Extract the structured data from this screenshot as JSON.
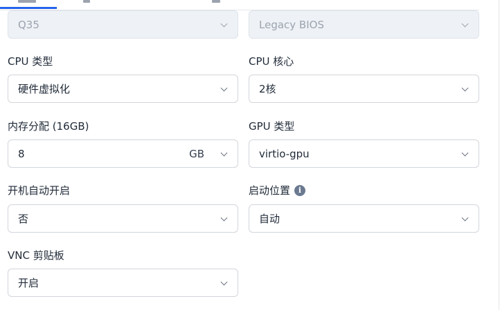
{
  "form": {
    "machine_type": {
      "value": "Q35"
    },
    "firmware": {
      "value": "Legacy BIOS"
    },
    "cpu_type": {
      "label": "CPU 类型",
      "value": "硬件虚拟化"
    },
    "cpu_cores": {
      "label": "CPU 核心",
      "value": "2核"
    },
    "memory": {
      "label": "内存分配 (16GB)",
      "value": "8",
      "unit": "GB"
    },
    "gpu_type": {
      "label": "GPU 类型",
      "value": "virtio-gpu"
    },
    "autostart": {
      "label": "开机自动开启",
      "value": "否"
    },
    "boot_location": {
      "label": "启动位置",
      "value": "自动",
      "info_icon": "info-icon"
    },
    "vnc_clipboard": {
      "label": "VNC 剪贴板",
      "value": "开启"
    }
  },
  "colors": {
    "accent": "#2563eb",
    "border": "#d1d5db",
    "disabled_bg": "#eef2f6",
    "info_icon": "#6b7a90"
  }
}
